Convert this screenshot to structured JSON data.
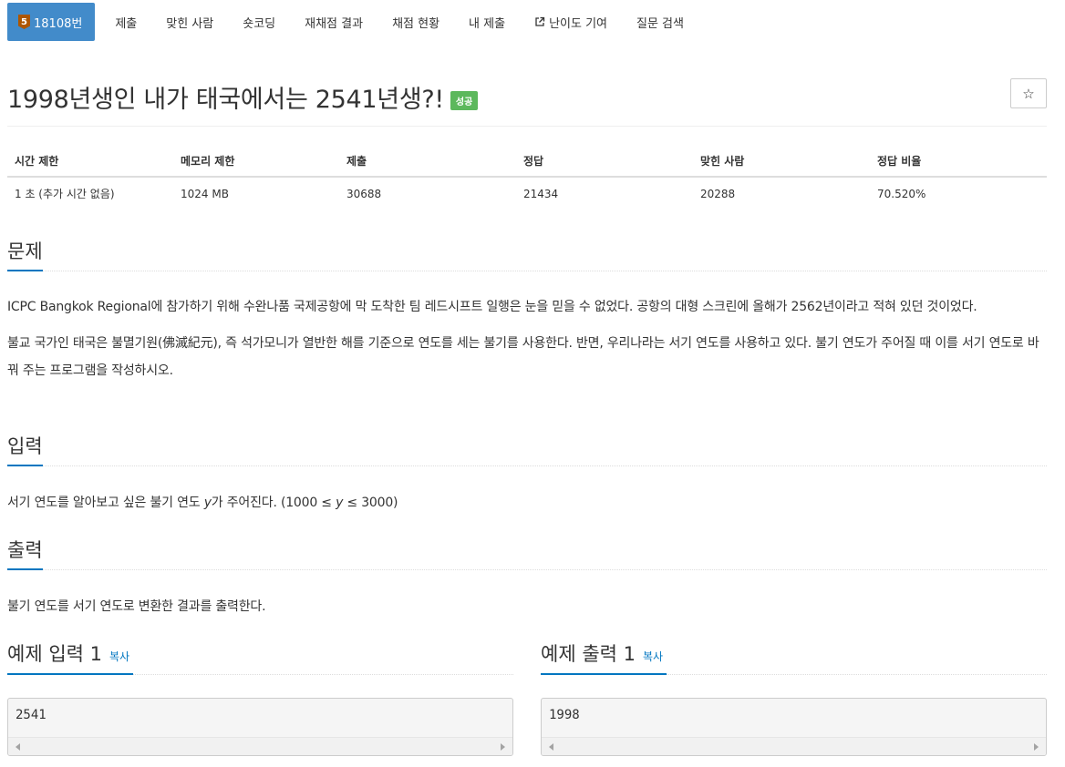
{
  "nav": {
    "problem_tab": {
      "tier": "5",
      "label": "18108번"
    },
    "items": [
      {
        "label": "제출"
      },
      {
        "label": "맞힌 사람"
      },
      {
        "label": "숏코딩"
      },
      {
        "label": "재채점 결과"
      },
      {
        "label": "채점 현황"
      },
      {
        "label": "내 제출"
      },
      {
        "label": "난이도 기여",
        "icon": "external-link-icon"
      },
      {
        "label": "질문 검색"
      }
    ]
  },
  "title": {
    "text": "1998년생인 내가 태국에서는 2541년생?!",
    "badge": "성공",
    "badge_color": "#5cb85c",
    "star": "☆"
  },
  "info_table": {
    "headers": [
      "시간 제한",
      "메모리 제한",
      "제출",
      "정답",
      "맞힌 사람",
      "정답 비율"
    ],
    "row": [
      "1 초 (추가 시간 없음)",
      "1024 MB",
      "30688",
      "21434",
      "20288",
      "70.520%"
    ]
  },
  "problem": {
    "heading": "문제",
    "paragraphs": [
      "ICPC Bangkok Regional에 참가하기 위해 수완나품 국제공항에 막 도착한 팀 레드시프트 일행은 눈을 믿을 수 없었다. 공항의 대형 스크린에 올해가 2562년이라고 적혀 있던 것이었다.",
      "불교 국가인 태국은 불멸기원(佛滅紀元), 즉 석가모니가 열반한 해를 기준으로 연도를 세는 불기를 사용한다. 반면, 우리나라는 서기 연도를 사용하고 있다. 불기 연도가 주어질 때 이를 서기 연도로 바꿔 주는 프로그램을 작성하시오."
    ]
  },
  "input": {
    "heading": "입력",
    "text_before": "서기 연도를 알아보고 싶은 불기 연도 ",
    "variable": "y",
    "text_after": "가 주어진다. (1000 ≤ ",
    "variable2": "y",
    "text_end": " ≤ 3000)"
  },
  "output": {
    "heading": "출력",
    "text": "불기 연도를 서기 연도로 변환한 결과를 출력한다."
  },
  "samples": [
    {
      "title": "예제 입력 1",
      "copy": "복사",
      "content": "2541"
    },
    {
      "title": "예제 출력 1",
      "copy": "복사",
      "content": "1998"
    }
  ],
  "colors": {
    "nav_active": "#428bca",
    "tier_bronze": "#ad5600",
    "section_underline": "#0076c0"
  }
}
